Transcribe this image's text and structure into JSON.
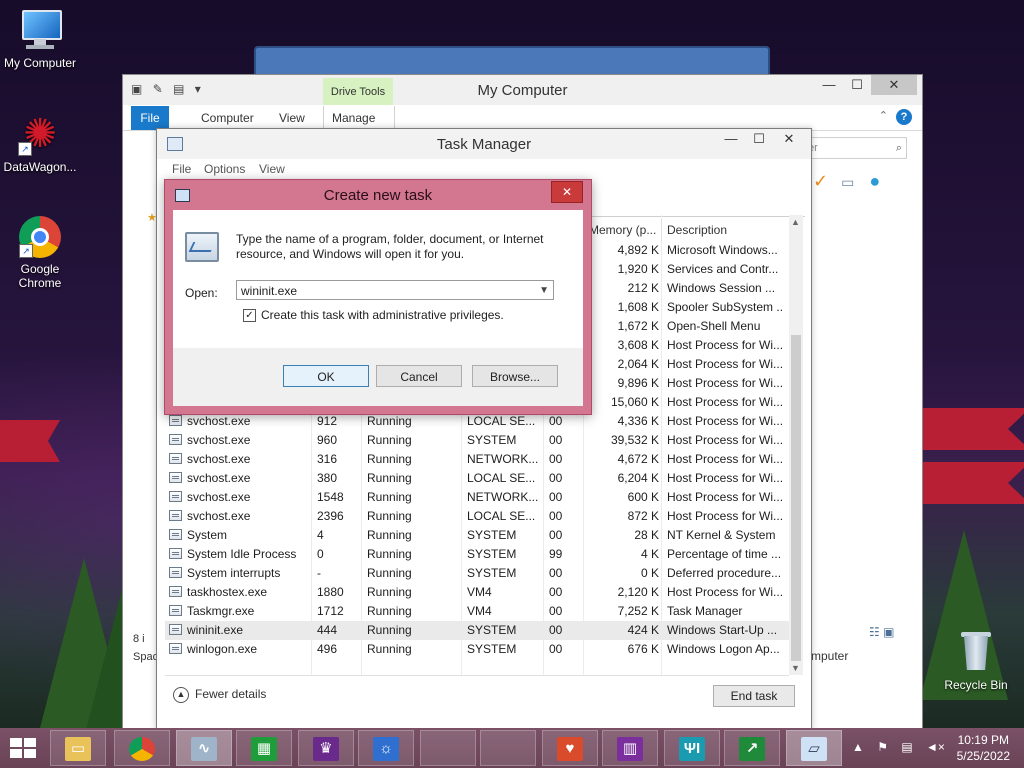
{
  "desktop": {
    "icons": [
      {
        "label": "My Computer"
      },
      {
        "label": "DataWagon..."
      },
      {
        "label": "Google Chrome"
      },
      {
        "label": "Recycle Bin"
      }
    ]
  },
  "explorer": {
    "title": "My Computer",
    "drive_tools": "Drive Tools",
    "tabs": [
      "File",
      "Computer",
      "View",
      "Manage"
    ],
    "search_placeholder": "er",
    "status_left_count": "8 i",
    "status_left_label": "Spac",
    "status_right": "mputer"
  },
  "taskmanager": {
    "title": "Task Manager",
    "menu": [
      "File",
      "Options",
      "View"
    ],
    "columns": [
      "Memory (p...",
      "Description"
    ],
    "rows": [
      {
        "name": "",
        "pid": "",
        "status": "",
        "user": "",
        "cpu": "",
        "mem": "4,892 K",
        "desc": "Microsoft Windows..."
      },
      {
        "name": "",
        "pid": "",
        "status": "",
        "user": "",
        "cpu": "",
        "mem": "1,920 K",
        "desc": "Services and Contr..."
      },
      {
        "name": "",
        "pid": "",
        "status": "",
        "user": "",
        "cpu": "",
        "mem": "212 K",
        "desc": "Windows Session ..."
      },
      {
        "name": "",
        "pid": "",
        "status": "",
        "user": "",
        "cpu": "",
        "mem": "1,608 K",
        "desc": "Spooler SubSystem ..."
      },
      {
        "name": "",
        "pid": "",
        "status": "",
        "user": "",
        "cpu": "",
        "mem": "1,672 K",
        "desc": "Open-Shell Menu"
      },
      {
        "name": "",
        "pid": "",
        "status": "",
        "user": "",
        "cpu": "",
        "mem": "3,608 K",
        "desc": "Host Process for Wi..."
      },
      {
        "name": "",
        "pid": "",
        "status": "",
        "user": "",
        "cpu": "",
        "mem": "2,064 K",
        "desc": "Host Process for Wi..."
      },
      {
        "name": "",
        "pid": "",
        "status": "",
        "user": "",
        "cpu": "",
        "mem": "9,896 K",
        "desc": "Host Process for Wi..."
      },
      {
        "name": "",
        "pid": "",
        "status": "",
        "user": "",
        "cpu": "",
        "mem": "15,060 K",
        "desc": "Host Process for Wi..."
      },
      {
        "name": "svchost.exe",
        "pid": "912",
        "status": "Running",
        "user": "LOCAL SE...",
        "cpu": "00",
        "mem": "4,336 K",
        "desc": "Host Process for Wi..."
      },
      {
        "name": "svchost.exe",
        "pid": "960",
        "status": "Running",
        "user": "SYSTEM",
        "cpu": "00",
        "mem": "39,532 K",
        "desc": "Host Process for Wi..."
      },
      {
        "name": "svchost.exe",
        "pid": "316",
        "status": "Running",
        "user": "NETWORK...",
        "cpu": "00",
        "mem": "4,672 K",
        "desc": "Host Process for Wi..."
      },
      {
        "name": "svchost.exe",
        "pid": "380",
        "status": "Running",
        "user": "LOCAL SE...",
        "cpu": "00",
        "mem": "6,204 K",
        "desc": "Host Process for Wi..."
      },
      {
        "name": "svchost.exe",
        "pid": "1548",
        "status": "Running",
        "user": "NETWORK...",
        "cpu": "00",
        "mem": "600 K",
        "desc": "Host Process for Wi..."
      },
      {
        "name": "svchost.exe",
        "pid": "2396",
        "status": "Running",
        "user": "LOCAL SE...",
        "cpu": "00",
        "mem": "872 K",
        "desc": "Host Process for Wi..."
      },
      {
        "name": "System",
        "pid": "4",
        "status": "Running",
        "user": "SYSTEM",
        "cpu": "00",
        "mem": "28 K",
        "desc": "NT Kernel & System"
      },
      {
        "name": "System Idle Process",
        "pid": "0",
        "status": "Running",
        "user": "SYSTEM",
        "cpu": "99",
        "mem": "4 K",
        "desc": "Percentage of time ..."
      },
      {
        "name": "System interrupts",
        "pid": "-",
        "status": "Running",
        "user": "SYSTEM",
        "cpu": "00",
        "mem": "0 K",
        "desc": "Deferred procedure..."
      },
      {
        "name": "taskhostex.exe",
        "pid": "1880",
        "status": "Running",
        "user": "VM4",
        "cpu": "00",
        "mem": "2,120 K",
        "desc": "Host Process for Wi..."
      },
      {
        "name": "Taskmgr.exe",
        "pid": "1712",
        "status": "Running",
        "user": "VM4",
        "cpu": "00",
        "mem": "7,252 K",
        "desc": "Task Manager"
      },
      {
        "name": "wininit.exe",
        "pid": "444",
        "status": "Running",
        "user": "SYSTEM",
        "cpu": "00",
        "mem": "424 K",
        "desc": "Windows Start-Up ..."
      },
      {
        "name": "winlogon.exe",
        "pid": "496",
        "status": "Running",
        "user": "SYSTEM",
        "cpu": "00",
        "mem": "676 K",
        "desc": "Windows Logon Ap..."
      }
    ],
    "selected_row_name": "wininit.exe",
    "fewer_details": "Fewer details",
    "end_task": "End task"
  },
  "dialog": {
    "title": "Create new task",
    "close": "✕",
    "prompt": "Type the name of a program, folder, document, or Internet resource, and Windows will open it for you.",
    "open_label": "Open:",
    "open_value": "wininit.exe",
    "admin_checkbox_label": "Create this task with administrative privileges.",
    "admin_checked": true,
    "ok": "OK",
    "cancel": "Cancel",
    "browse": "Browse..."
  },
  "taskbar": {
    "clock_time": "10:19 PM",
    "clock_date": "5/25/2022"
  },
  "colors": {
    "dialog_frame": "#d2778f",
    "explorer_file_tab": "#1979ca",
    "taskbar": "#6a4357",
    "dialog_close": "#c93a3a"
  }
}
